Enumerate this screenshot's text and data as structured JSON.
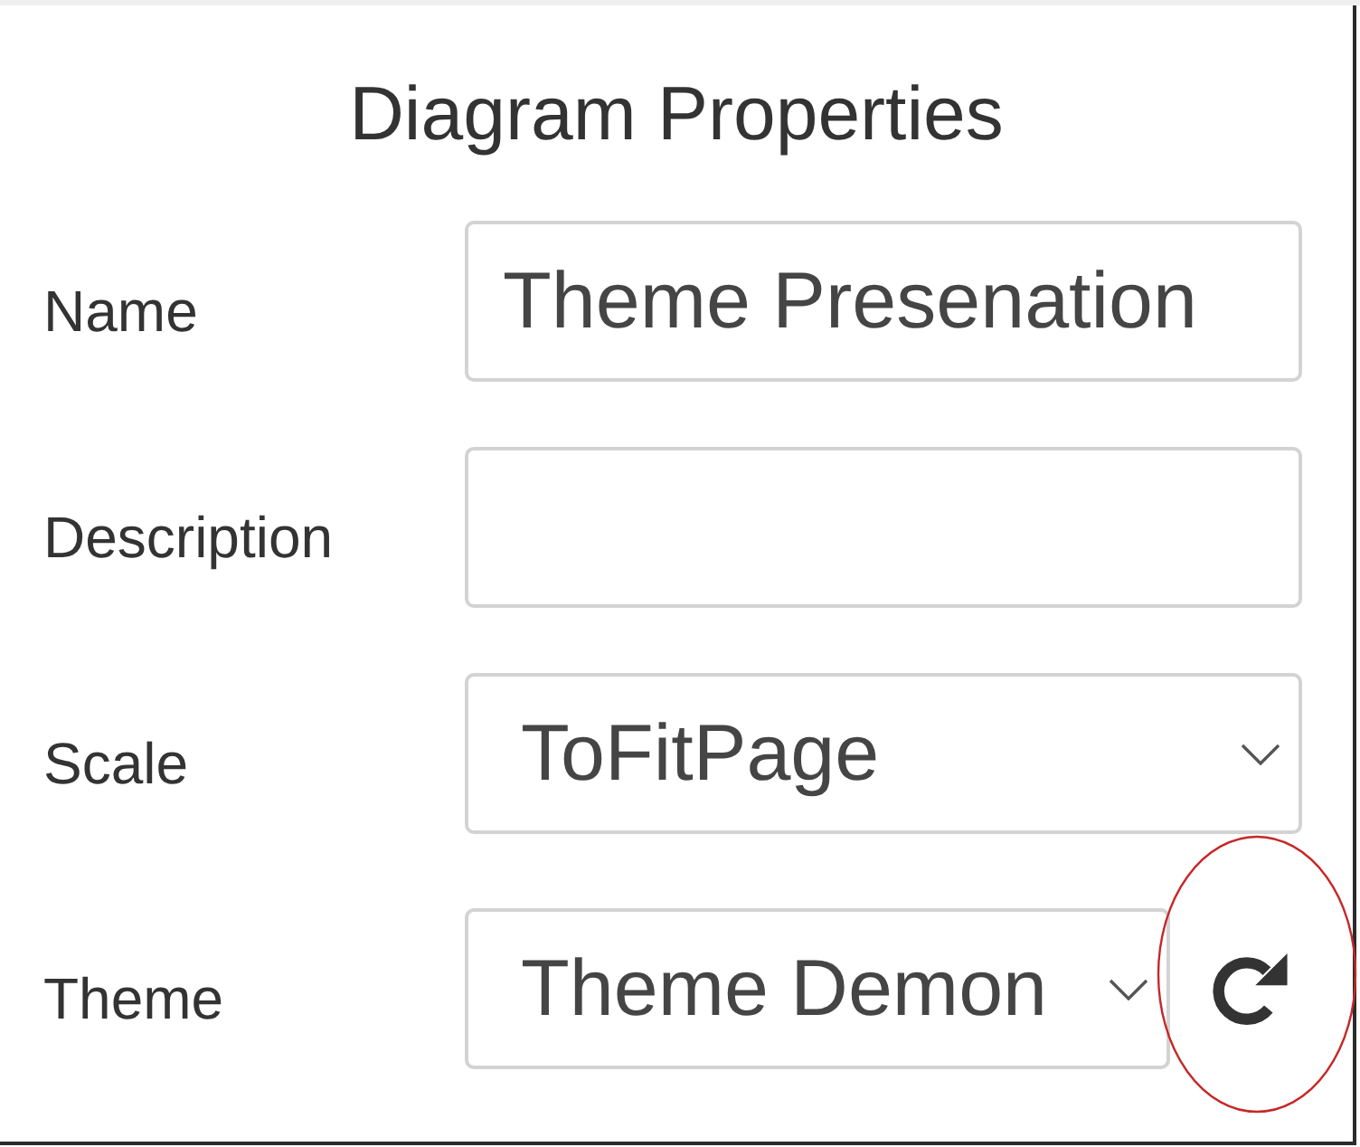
{
  "panel": {
    "title": "Diagram Properties",
    "fields": [
      {
        "kind": "text",
        "label": "Name",
        "value": "Theme Presenation"
      },
      {
        "kind": "text",
        "label": "Description"
      },
      {
        "kind": "select",
        "label": "Scale",
        "value": "ToFitPage"
      },
      {
        "kind": "select",
        "label": "Theme",
        "value": "Theme Demon",
        "refresh_button": {
          "highlighted": true
        }
      }
    ]
  }
}
